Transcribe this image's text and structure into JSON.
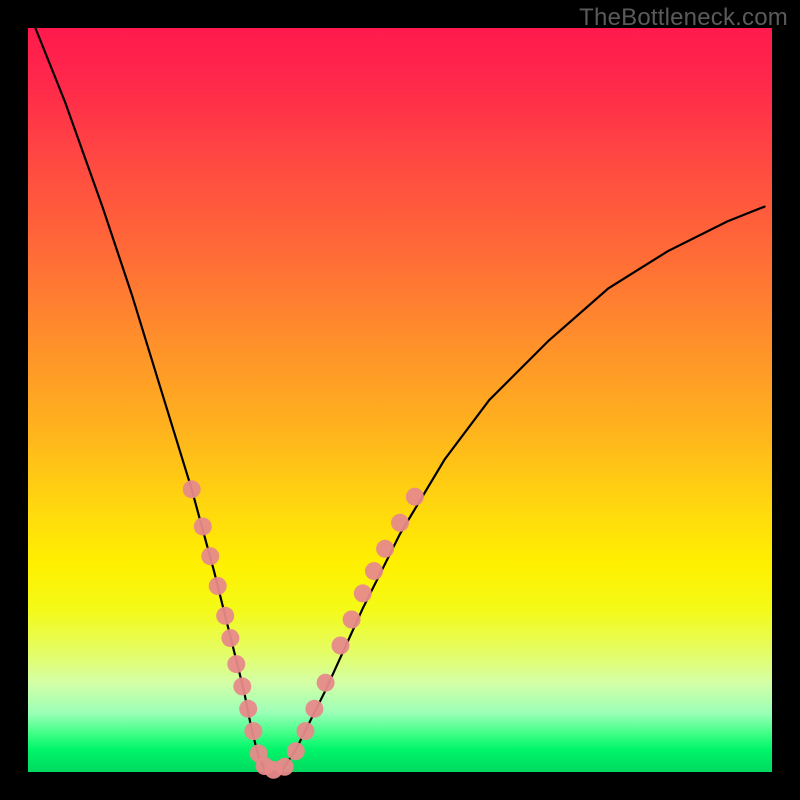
{
  "watermark": "TheBottleneck.com",
  "chart_data": {
    "type": "line",
    "title": "",
    "xlabel": "",
    "ylabel": "",
    "xlim": [
      0,
      100
    ],
    "ylim": [
      0,
      100
    ],
    "grid": false,
    "legend": false,
    "series": [
      {
        "name": "bottleneck-curve",
        "x": [
          1,
          5,
          10,
          14,
          18,
          22,
          25,
          27,
          29,
          30,
          31,
          32,
          34,
          36,
          40,
          45,
          50,
          56,
          62,
          70,
          78,
          86,
          94,
          99
        ],
        "y": [
          100,
          90,
          76,
          64,
          51,
          38,
          27,
          19,
          11,
          6,
          2,
          0,
          0,
          3,
          11,
          22,
          32,
          42,
          50,
          58,
          65,
          70,
          74,
          76
        ],
        "stroke": "#000000",
        "stroke_width": 2.2
      }
    ],
    "markers": {
      "name": "highlight-points",
      "color": "#e78a8a",
      "radius": 9,
      "points": [
        {
          "x": 22.0,
          "y": 38.0
        },
        {
          "x": 23.5,
          "y": 33.0
        },
        {
          "x": 24.5,
          "y": 29.0
        },
        {
          "x": 25.5,
          "y": 25.0
        },
        {
          "x": 26.5,
          "y": 21.0
        },
        {
          "x": 27.2,
          "y": 18.0
        },
        {
          "x": 28.0,
          "y": 14.5
        },
        {
          "x": 28.8,
          "y": 11.5
        },
        {
          "x": 29.6,
          "y": 8.5
        },
        {
          "x": 30.3,
          "y": 5.5
        },
        {
          "x": 31.0,
          "y": 2.5
        },
        {
          "x": 31.8,
          "y": 0.8
        },
        {
          "x": 33.0,
          "y": 0.3
        },
        {
          "x": 34.5,
          "y": 0.7
        },
        {
          "x": 36.0,
          "y": 2.8
        },
        {
          "x": 37.3,
          "y": 5.5
        },
        {
          "x": 38.5,
          "y": 8.5
        },
        {
          "x": 40.0,
          "y": 12.0
        },
        {
          "x": 42.0,
          "y": 17.0
        },
        {
          "x": 43.5,
          "y": 20.5
        },
        {
          "x": 45.0,
          "y": 24.0
        },
        {
          "x": 46.5,
          "y": 27.0
        },
        {
          "x": 48.0,
          "y": 30.0
        },
        {
          "x": 50.0,
          "y": 33.5
        },
        {
          "x": 52.0,
          "y": 37.0
        }
      ]
    },
    "background_gradient_stops": [
      {
        "pos": 0.0,
        "color": "#ff1a4d"
      },
      {
        "pos": 0.3,
        "color": "#ff6a37"
      },
      {
        "pos": 0.55,
        "color": "#ffc514"
      },
      {
        "pos": 0.75,
        "color": "#fff000"
      },
      {
        "pos": 0.9,
        "color": "#baffad"
      },
      {
        "pos": 0.97,
        "color": "#00f56a"
      },
      {
        "pos": 1.0,
        "color": "#00d95e"
      }
    ]
  }
}
